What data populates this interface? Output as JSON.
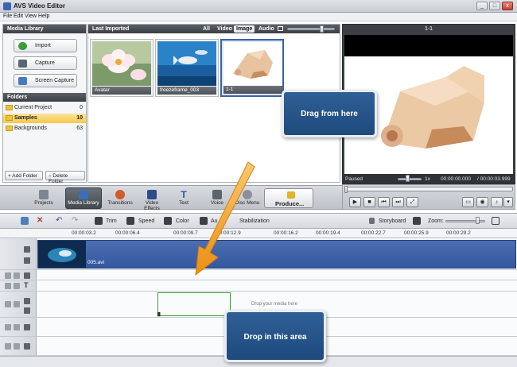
{
  "window": {
    "title": "AVS Video Editor",
    "controls": [
      "_",
      "□",
      "x"
    ]
  },
  "menu": [
    "File",
    "Edit",
    "View",
    "Help"
  ],
  "media_library": {
    "header": "Media Library",
    "buttons": [
      "Import",
      "Capture",
      "Screen Capture"
    ],
    "folders_header": "Folders",
    "folders": [
      {
        "name": "Current Project",
        "count": "0"
      },
      {
        "name": "Samples",
        "count": "10"
      },
      {
        "name": "Backgrounds",
        "count": "63"
      }
    ],
    "add_folder": "+ Add Folder",
    "delete_folder": "– Delete Folder"
  },
  "media_panel": {
    "header": "Last Imported",
    "filters": [
      "All",
      "Video",
      "Image",
      "Audio"
    ],
    "active_filter": "Image",
    "items": [
      {
        "label": "Avatar"
      },
      {
        "label": "freezeframe_003"
      },
      {
        "label": "1-1"
      }
    ]
  },
  "preview": {
    "title": "1-1",
    "status": "Paused",
    "speed": "1x",
    "time_current": "00:00:00.000",
    "time_total": "/ 00:00:03.999"
  },
  "toolbar": {
    "buttons": [
      "Projects",
      "Media Library",
      "Transitions",
      "Video Effects",
      "Text",
      "Voice",
      "Disc Menu"
    ],
    "active": "Media Library",
    "produce": "Produce..."
  },
  "timeline_toolbar": {
    "items": [
      "Trim",
      "Speed",
      "Color",
      "Au",
      "Stabilization"
    ],
    "storyboard": "Storyboard",
    "zoom": "Zoom:"
  },
  "ruler": {
    "ticks": [
      "00:00:03.2",
      "00:00:06.4",
      "00:00:09.7",
      "00:00:12.9",
      "00:00:16.2",
      "00:00:19.4",
      "00:00:22.7",
      "00:00:25.9",
      "00:00:29.2"
    ]
  },
  "timeline": {
    "clip_label": "005.avi",
    "drop_hint": "Drop your media here"
  },
  "callouts": {
    "drag": "Drag from here",
    "drop": "Drop in this area"
  },
  "colors": {
    "accent": "#3a62a8",
    "callout": "#1e4a7d",
    "arrow": "#f0a020",
    "drop_border": "#36a035"
  }
}
